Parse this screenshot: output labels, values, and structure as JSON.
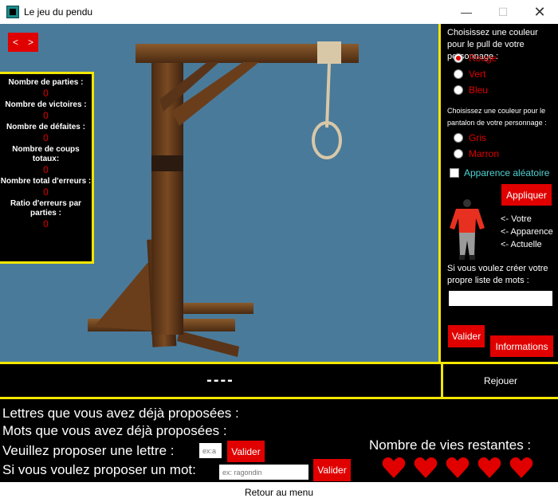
{
  "window": {
    "title": "Le jeu du pendu",
    "min_icon": "minimize-icon",
    "max_icon": "maximize-icon",
    "close_icon": "close-icon"
  },
  "nav": {
    "prev": "<",
    "next": ">"
  },
  "stats": [
    {
      "label": "Nombre de parties :",
      "value": "0"
    },
    {
      "label": "Nombre de victoires :",
      "value": "0"
    },
    {
      "label": "Nombre de défaites :",
      "value": "0"
    },
    {
      "label": "Nombre de coups totaux:",
      "value": "0"
    },
    {
      "label": "Nombre total d'erreurs :",
      "value": "0"
    },
    {
      "label": "Ratio d'erreurs par parties :",
      "value": "0"
    }
  ],
  "customize": {
    "shirt_prompt": "Choisissez une couleur pour le pull de votre personnage :",
    "shirt_options": [
      "Rouge",
      "Vert",
      "Bleu"
    ],
    "shirt_selected": "Rouge",
    "pants_prompt": "Choisissez une couleur pour le pantalon de votre personnage :",
    "pants_options": [
      "Gris",
      "Marron"
    ],
    "random_label": "Apparence aléatoire",
    "apply_label": "Appliquer",
    "preview_caption": [
      "<- Votre",
      "<- Apparence",
      "<- Actuelle"
    ],
    "wordlist_prompt": "Si vous voulez créer votre propre liste de mots :",
    "wordlist_value": "",
    "validate_label": "Valider",
    "info_label": "Informations"
  },
  "word_display": "----",
  "replay_label": "Rejouer",
  "bottom": {
    "letters_label": "Lettres que vous avez déjà proposées :",
    "words_label": "Mots que vous avez déjà proposées :",
    "letter_prompt": "Veuillez proposer une lettre :",
    "letter_placeholder": "ex:a",
    "letter_validate": "Valider",
    "word_prompt": "Si vous voulez proposer un mot:",
    "word_placeholder": "ex: ragondin",
    "word_validate": "Valider",
    "lives_label": "Nombre de vies restantes :",
    "lives": 5
  },
  "footer": {
    "menu_label": "Retour au menu"
  },
  "colors": {
    "accent_red": "#e00000",
    "border_yellow": "#f5e600",
    "scene_blue": "#4a7a9a",
    "cyan_text": "#4fd2d2"
  }
}
